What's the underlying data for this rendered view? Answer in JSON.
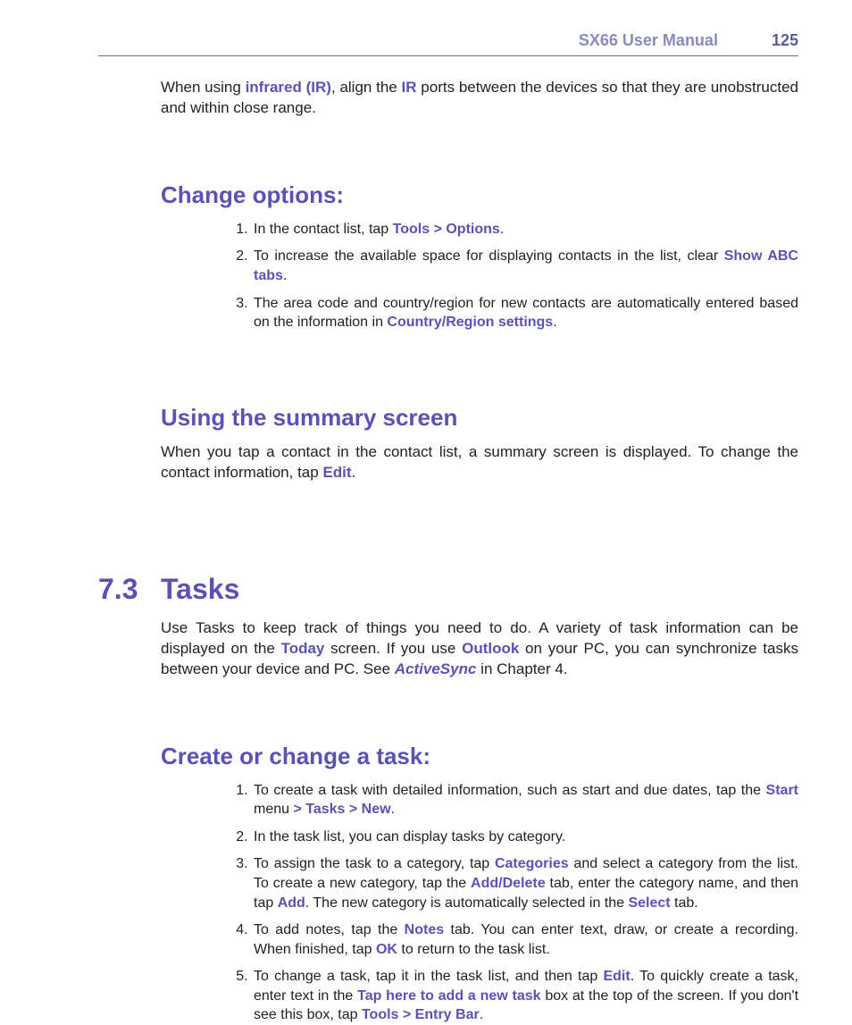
{
  "header": {
    "title": "SX66 User Manual",
    "page": "125"
  },
  "intro": {
    "t1": "When using ",
    "em1": "infrared (IR)",
    "t2": ", align the ",
    "em2": "IR",
    "t3": " ports between the devices so that they are unobstructed and within close range."
  },
  "sec1": {
    "heading": "Change options:",
    "li1": {
      "t1": "In the contact list, tap ",
      "em1": "Tools > Options",
      "t2": "."
    },
    "li2": {
      "t1": "To increase the available space for displaying contacts in the list, clear ",
      "em1": "Show ABC tabs",
      "t2": "."
    },
    "li3": {
      "t1": "The area code and country/region for new contacts are automatically entered based on the information in ",
      "em1": "Country/Region settings",
      "t2": "."
    }
  },
  "sec2": {
    "heading": "Using the summary screen",
    "p": {
      "t1": "When you tap a contact in the contact list, a summary screen is displayed. To change the contact information, tap ",
      "em1": "Edit",
      "t2": "."
    }
  },
  "sec3": {
    "num": "7.3",
    "heading": "Tasks",
    "p": {
      "t1": "Use Tasks to keep track of things you need to do. A variety of task information can be displayed on the ",
      "em1": "Today",
      "t2": " screen. If you use ",
      "em2": "Outlook",
      "t3": " on your PC, you can synchronize tasks between your device and PC. See ",
      "em3": "ActiveSync",
      "t4": " in Chapter 4."
    }
  },
  "sec4": {
    "heading": "Create or change a task:",
    "li1": {
      "t1": "To create a task with detailed information, such as start and due dates, tap the ",
      "em1": "Start",
      "t2": " menu ",
      "em2": "> Tasks > New",
      "t3": "."
    },
    "li2": {
      "t1": "In the task list, you can display tasks by category."
    },
    "li3": {
      "t1": "To assign the task to a category, tap ",
      "em1": "Categories",
      "t2": " and select a category from the list. To create a new category, tap the ",
      "em2": "Add/Delete",
      "t3": " tab, enter the category name, and then tap ",
      "em3": "Add",
      "t4": ". The new category is automatically selected in the ",
      "em4": "Select",
      "t5": " tab."
    },
    "li4": {
      "t1": "To add notes, tap the ",
      "em1": "Notes",
      "t2": " tab. You can enter text, draw, or create a recording. When finished, tap ",
      "em2": "OK",
      "t3": " to return to the task list."
    },
    "li5": {
      "t1": "To change a task, tap it in the task list, and then tap ",
      "em1": "Edit",
      "t2": ". To quickly create a task, enter text in the ",
      "em2": "Tap here to add a new task",
      "t3": " box at the top of the screen. If you don't see this box, tap ",
      "em3": "Tools > Entry Bar",
      "t4": "."
    }
  }
}
